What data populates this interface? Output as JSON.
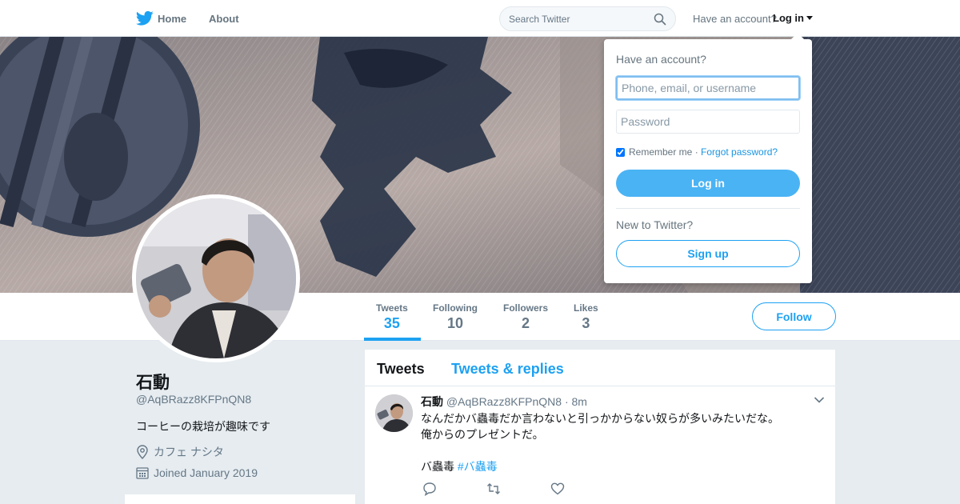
{
  "topbar": {
    "logo_icon": "twitter-bird-icon",
    "home_label": "Home",
    "about_label": "About",
    "search_placeholder": "Search Twitter",
    "search_icon": "search-icon",
    "have_account": "Have an account?",
    "login_label": "Log in"
  },
  "banner": {
    "description_icon": "gears-photo"
  },
  "stats": [
    {
      "label": "Tweets",
      "value": "35"
    },
    {
      "label": "Following",
      "value": "10"
    },
    {
      "label": "Followers",
      "value": "2"
    },
    {
      "label": "Likes",
      "value": "3"
    }
  ],
  "follow_label": "Follow",
  "profile": {
    "name": "石動",
    "handle": "@AqBRazz8KFPnQN8",
    "bio": "コーヒーの栽培が趣味です",
    "location": "カフェ ナシタ",
    "joined": "Joined January 2019"
  },
  "timeline": {
    "tabs": [
      "Tweets",
      "Tweets & replies"
    ],
    "tweet": {
      "name": "石動",
      "handle": "@AqBRazz8KFPnQN8",
      "sep_time": "· 8m",
      "lines": [
        "なんだかバ蟲毒だか言わないと引っかからない奴らが多いみたいだな。",
        "俺からのプレゼントだ。"
      ],
      "last_line_text": "バ蟲毒 ",
      "hashtag": "#バ蟲毒"
    }
  },
  "login_dropdown": {
    "title": "Have an account?",
    "username_placeholder": "Phone, email, or username",
    "password_placeholder": "Password",
    "remember_label": "Remember me · ",
    "forgot_label": "Forgot password?",
    "login_button": "Log in",
    "new_label": "New to Twitter?",
    "signup_button": "Sign up"
  },
  "colors": {
    "accent": "#1da1f2",
    "login_button": "#4ab3f4",
    "page_bg": "#e6ecf0"
  }
}
